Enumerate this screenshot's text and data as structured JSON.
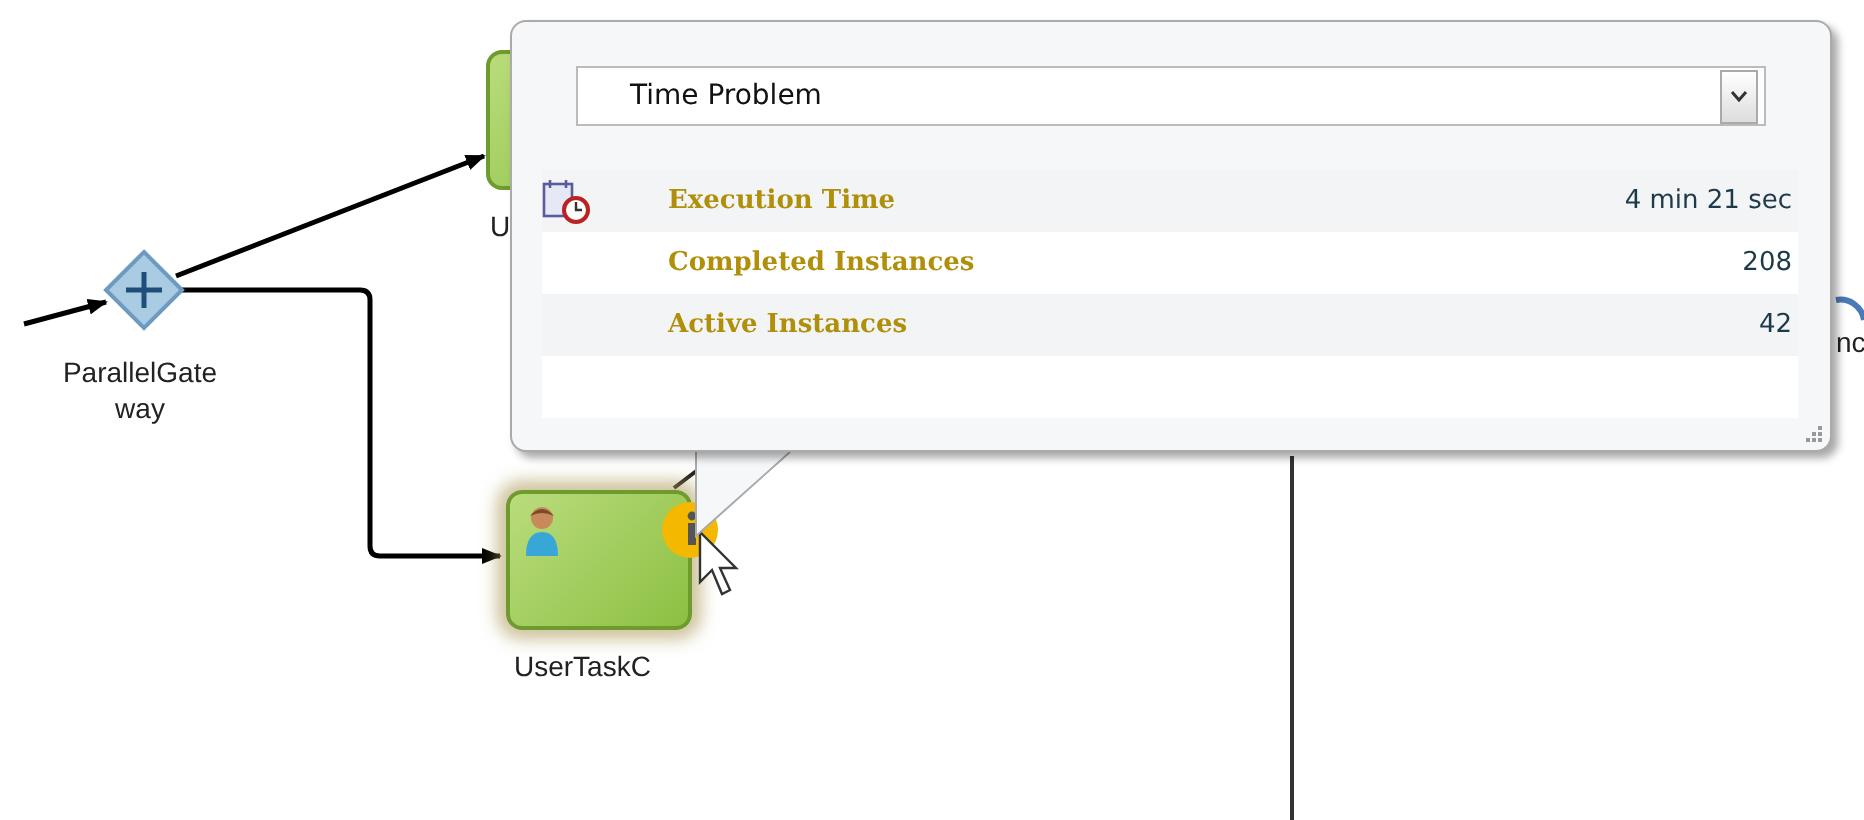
{
  "diagram": {
    "gateway": {
      "label_lines": [
        "ParallelGate",
        "way"
      ]
    },
    "tasks": [
      {
        "label": "U",
        "selected": false
      },
      {
        "label": "UserTaskC",
        "selected": true
      }
    ],
    "edge_label": "nc"
  },
  "popup": {
    "dropdown": {
      "value": "Time Problem"
    },
    "metrics": [
      {
        "label": "Execution Time",
        "value": "4 min 21 sec"
      },
      {
        "label": "Completed Instances",
        "value": "208"
      },
      {
        "label": "Active Instances",
        "value": "42"
      }
    ]
  }
}
